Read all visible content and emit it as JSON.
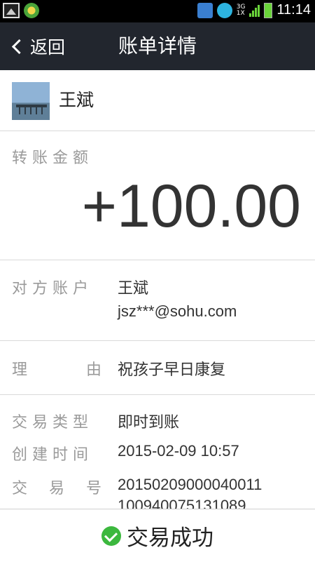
{
  "status_bar": {
    "network": "3G",
    "network2": "1X",
    "time": "11:14"
  },
  "header": {
    "back_label": "返回",
    "title": "账单详情"
  },
  "payee": {
    "name": "王斌"
  },
  "amount": {
    "label": "转账金额",
    "value": "+100.00"
  },
  "account": {
    "label": "对方账户",
    "name": "王斌",
    "email": "jsz***@sohu.com"
  },
  "reason": {
    "label_chars": [
      "理",
      "由"
    ],
    "value": "祝孩子早日康复"
  },
  "transaction": {
    "type_label": "交易类型",
    "type_value": "即时到账",
    "created_label": "创建时间",
    "created_value": "2015-02-09 10:57",
    "number_label_chars": [
      "交",
      "易",
      "号"
    ],
    "number_line1": "20150209000040011",
    "number_line2": "100940075131089"
  },
  "footer": {
    "status_text": "交易成功",
    "status_color": "#3cb83e"
  }
}
